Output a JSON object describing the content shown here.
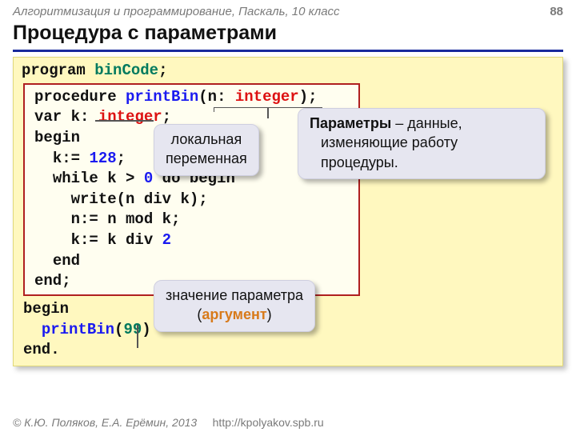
{
  "header": {
    "course": "Алгоритмизация и программирование, Паскаль, 10 класс",
    "page": "88"
  },
  "title": "Процедура с параметрами",
  "code": {
    "program_kw": "program",
    "program_id": "binCode",
    "semi": ";",
    "procedure_kw": "procedure",
    "procedure_id": "printBin",
    "open": "(",
    "param_n": "n",
    "colon": ":",
    "type_int": "integer",
    "close": ")",
    "var_kw": "var",
    "var_k": "k",
    "begin_kw": "begin",
    "assign_k_128_l": "k:=",
    "num_128": "128",
    "while_kw": "while",
    "cond": "k >",
    "zero": "0",
    "do_begin": "do begin",
    "write_call": "write(n",
    "div_kw": "div",
    "write_rhs": "k);",
    "n_assign": "n:= n",
    "mod_kw": "mod",
    "n_assign_rhs": "k;",
    "k_assign": "k:= k",
    "k_assign_rhs_num": "2",
    "end_kw": "end",
    "end_semi": "end;",
    "main_begin": "begin",
    "call_id": "printBin",
    "call_open": "(",
    "call_arg": "99",
    "call_close": ")",
    "end_dot": "end."
  },
  "callouts": {
    "local_var_l1": "локальная",
    "local_var_l2": "переменная",
    "params_strong": "Параметры",
    "params_rest_l1": " – данные,",
    "params_l2": "изменяющие работу",
    "params_l3": "процедуры.",
    "arg_l1": "значение параметра",
    "arg_l2_open": "(",
    "arg_l2_word": "аргумент",
    "arg_l2_close": ")"
  },
  "footer": {
    "copyright": "© К.Ю. Поляков, Е.А. Ерёмин, 2013",
    "url": "http://kpolyakov.spb.ru"
  }
}
